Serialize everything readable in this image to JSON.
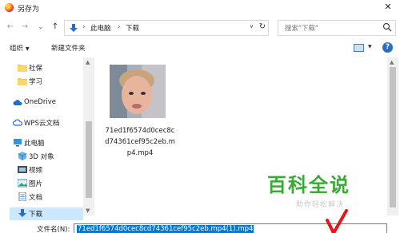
{
  "window": {
    "title": "另存为",
    "close_glyph": "✕"
  },
  "nav": {
    "back_glyph": "←",
    "forward_glyph": "→",
    "recent_glyph": "⌄",
    "up_glyph": "↑",
    "breadcrumb": [
      "此电脑",
      "下载"
    ],
    "breadcrumb_sep": "›",
    "dropdown_glyph": "∨",
    "refresh_glyph": "↻",
    "search_placeholder": "搜索\"下载\""
  },
  "toolbar": {
    "organize_label": "组织",
    "dropdown_glyph": "▼",
    "new_folder_label": "新建文件夹",
    "help_glyph": "?"
  },
  "sidebar": {
    "items": [
      {
        "label": "社保",
        "icon": "folder-icon"
      },
      {
        "label": "学习",
        "icon": "folder-icon"
      },
      {
        "label": "OneDrive",
        "icon": "cloud-icon"
      },
      {
        "label": "WPS云文档",
        "icon": "wps-cloud-icon"
      },
      {
        "label": "此电脑",
        "icon": "computer-icon"
      },
      {
        "label": "3D 对象",
        "icon": "cube-icon"
      },
      {
        "label": "视频",
        "icon": "video-icon"
      },
      {
        "label": "图片",
        "icon": "picture-icon"
      },
      {
        "label": "文档",
        "icon": "document-icon"
      },
      {
        "label": "下载",
        "icon": "download-icon",
        "selected": true
      }
    ]
  },
  "files": [
    {
      "name": "71ed1f6574d0cec8cd74361cef95c2eb.mp4.mp4",
      "type": "video-thumbnail"
    }
  ],
  "save": {
    "filename_label": "文件名(N):",
    "filename_value": "71ed1f6574d0cec8cd74361cef95c2eb.mp4(1).mp4"
  },
  "watermark": {
    "brand": "百科全说",
    "subtitle": "助你轻松解决"
  },
  "colors": {
    "selection_blue": "#0078d7",
    "sidebar_selected": "#cce8ff",
    "folder_yellow": "#f6c94a",
    "brand_green": "#3aaa35",
    "annotation_red": "#e3161c"
  }
}
